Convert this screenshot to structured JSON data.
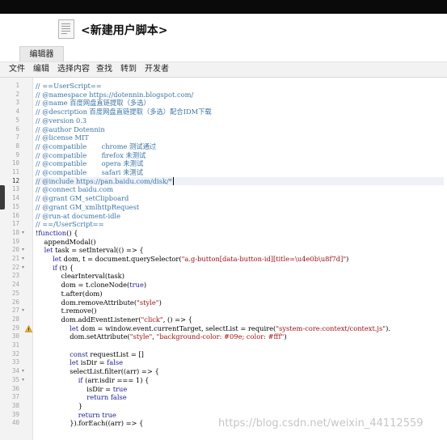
{
  "header": {
    "title": "<新建用户脚本>",
    "icon": "script-document-icon"
  },
  "tabs": [
    {
      "label": "编辑器"
    }
  ],
  "menu": [
    "文件",
    "编辑",
    "选择内容",
    "查找",
    "转到",
    "开发者"
  ],
  "editor": {
    "current_line": 12,
    "warning_line": 29,
    "fold_lines": [
      18,
      20,
      21,
      22,
      27,
      34,
      35
    ],
    "lines": [
      "// ==UserScript==",
      "// @namespace https://dotennin.blogspot.com/",
      "// @name 百度网盘直链提取（多选）",
      "// @description 百度网盘直链提取（多选）配合IDM下载",
      "// @version 0.3",
      "// @author Dotennin",
      "// @license MIT",
      "// @compatible       chrome 测试通过",
      "// @compatible       firefox 未测试",
      "// @compatible       opera 未测试",
      "// @compatible       safari 未测试",
      "// @include https://pan.baidu.com/disk/*",
      "// @connect baidu.com",
      "// @grant GM_setClipboard",
      "// @grant GM_xmlhttpRequest",
      "// @run-at document-idle",
      "// ==/UserScript==",
      "!function() {",
      "    appendModal()",
      "    let task = setInterval(() => {",
      "        let dom, t = document.querySelector(\"a.g-button[data-button-id][title=\\u4e0b\\u8f7d]\")",
      "        if (t) {",
      "            clearInterval(task)",
      "            dom = t.cloneNode(true)",
      "            t.after(dom)",
      "            dom.removeAttribute(\"style\")",
      "            t.remove()",
      "            dom.addEventListener(\"click\", () => {",
      "                let dom = window.event.currentTarget, selectList = require(\"system-core:context/context.js\").",
      "                dom.setAttribute(\"style\", \"background-color: #09e; color: #fff\")",
      "",
      "                const requestList = []",
      "                let isDir = false",
      "                selectList.filter((arr) => {",
      "                    if (arr.isdir === 1) {",
      "                        isDir = true",
      "                        return false",
      "                    }",
      "                    return true",
      "                }).forEach((arr) => {"
    ]
  },
  "watermark": "https://blog.csdn.net/weixin_44112559"
}
